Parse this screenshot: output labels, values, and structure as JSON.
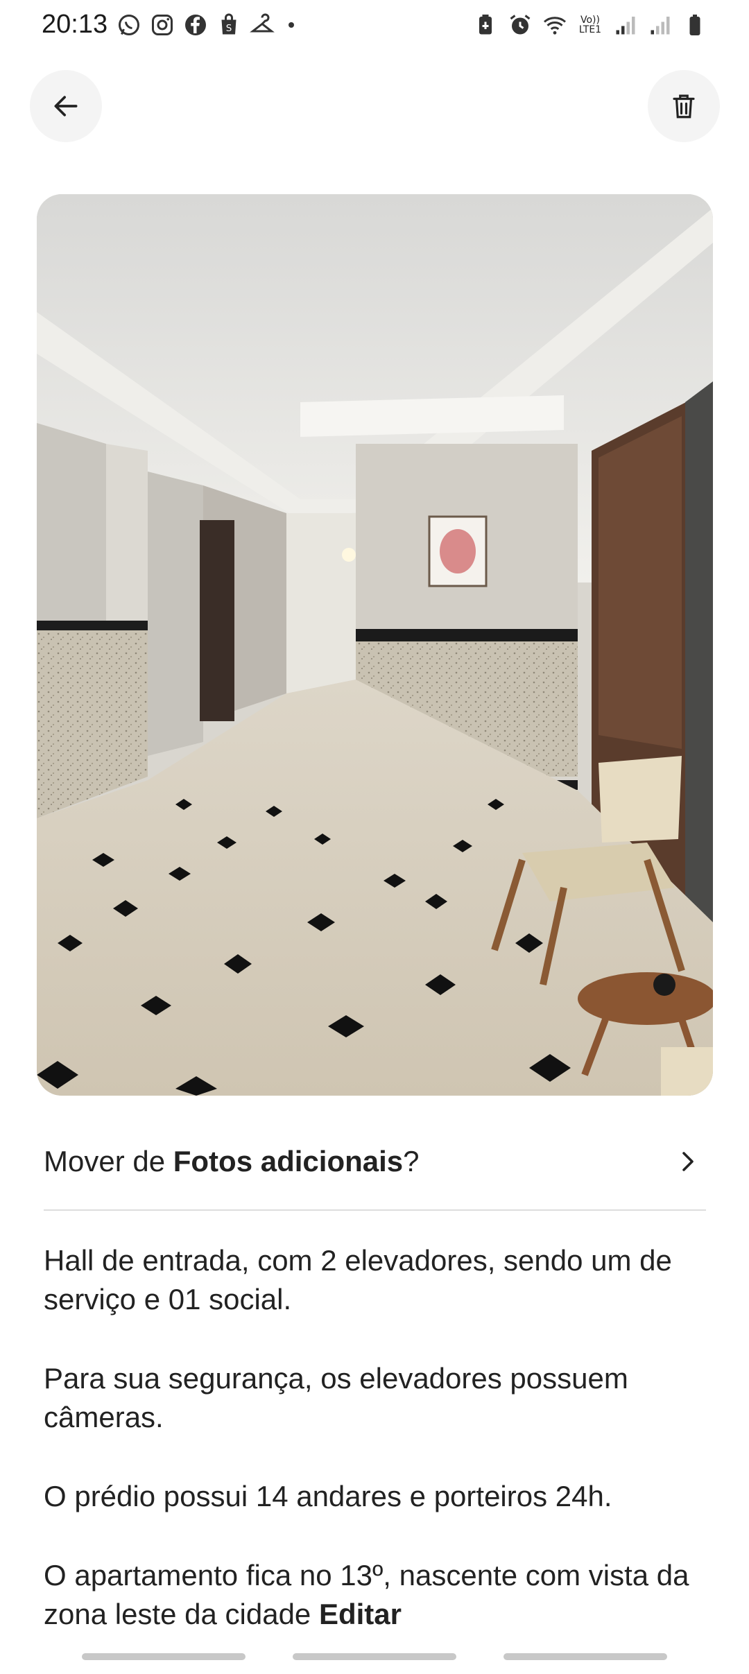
{
  "status_bar": {
    "time": "20:13",
    "left_icons": [
      "whatsapp-icon",
      "instagram-icon",
      "facebook-icon",
      "shopping-bag-icon",
      "hanger-icon"
    ],
    "right_icons": [
      "battery-saver-icon",
      "alarm-icon",
      "wifi-icon",
      "volte-icon",
      "signal-1-icon",
      "signal-2-icon",
      "battery-icon"
    ],
    "volte_label": "Vo)) LTE1"
  },
  "header": {
    "back_icon": "arrow-left-icon",
    "delete_icon": "trash-icon"
  },
  "photo": {
    "subject": "hall-de-entrada"
  },
  "move_row": {
    "prefix": "Mover de ",
    "album": "Fotos adicionais",
    "suffix": "?",
    "chevron_icon": "chevron-right-icon"
  },
  "description": {
    "paragraph_1": "Hall de entrada, com 2 elevadores, sendo um de serviço e 01 social.",
    "paragraph_2": "Para sua segurança, os elevadores possuem câmeras.",
    "paragraph_3": "O prédio possui 14 andares e porteiros 24h.",
    "paragraph_4": "O apartamento fica no 13º, nascente com vista da zona leste da cidade",
    "edit_label": "Editar"
  },
  "colors": {
    "text": "#222222",
    "divider": "#dddddd",
    "button_bg": "#f4f4f4"
  }
}
